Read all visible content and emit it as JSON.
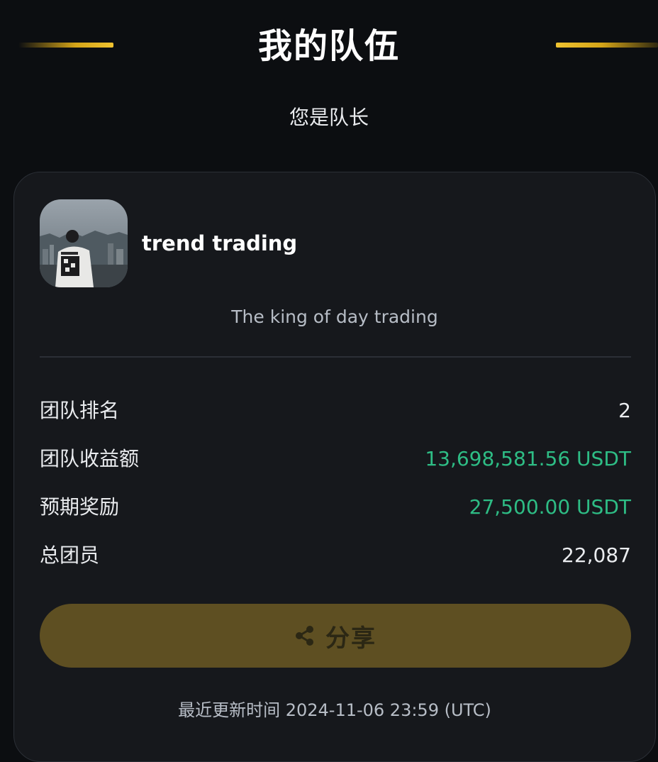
{
  "header": {
    "title": "我的队伍",
    "subtitle": "您是队长"
  },
  "team": {
    "avatar_icon": "team-avatar-photo",
    "name": "trend trading",
    "slogan": "The king of day trading"
  },
  "stats": [
    {
      "label": "团队排名",
      "value": "2",
      "color": "#eaecef"
    },
    {
      "label": "团队收益额",
      "value": "13,698,581.56 USDT",
      "color": "#2ebd85"
    },
    {
      "label": "预期奖励",
      "value": "27,500.00 USDT",
      "color": "#2ebd85"
    },
    {
      "label": "总团员",
      "value": "22,087",
      "color": "#eaecef"
    }
  ],
  "share_button": {
    "icon": "share-icon",
    "label": "分享"
  },
  "footer": {
    "last_updated": "最近更新时间 2024-11-06 23:59 (UTC)"
  },
  "colors": {
    "background": "#0c0e11",
    "card": "#16181c",
    "accent_gold": "#f0c330",
    "button": "#5e4f22",
    "positive": "#2ebd85"
  }
}
